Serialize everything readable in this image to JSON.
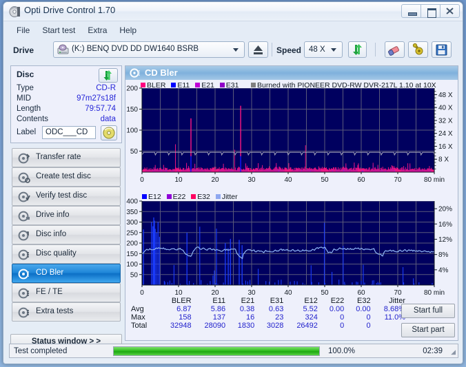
{
  "window": {
    "title": "Opti Drive Control 1.70",
    "icon": "disc-icon",
    "minimize": "minimize",
    "maximize": "maximize",
    "close": "close"
  },
  "menu": {
    "items": [
      {
        "label": "File"
      },
      {
        "label": "Start test"
      },
      {
        "label": "Extra"
      },
      {
        "label": "Help"
      }
    ]
  },
  "toolbar": {
    "drive_label": "Drive",
    "drive_value": "(K:)  BENQ DVD DD DW1640 BSRB",
    "eject_icon": "eject-icon",
    "speed_label": "Speed",
    "speed_value": "48 X",
    "refresh_icon": "refresh-icon",
    "erase_icon": "eraser-icon",
    "settings_icon": "settings-icon",
    "save_icon": "save-icon"
  },
  "disc": {
    "header": "Disc",
    "refresh_icon": "refresh-icon",
    "rows": [
      {
        "key": "Type",
        "value": "CD-R"
      },
      {
        "key": "MID",
        "value": "97m27s18f"
      },
      {
        "key": "Length",
        "value": "79:57.74"
      },
      {
        "key": "Contents",
        "value": "data"
      }
    ],
    "label_key": "Label",
    "label_value": "ODC___CD",
    "burn_icon": "cd-icon"
  },
  "nav": {
    "items": [
      {
        "label": "Transfer rate",
        "icon": "disc-test-icon",
        "selected": false
      },
      {
        "label": "Create test disc",
        "icon": "disc-test-icon",
        "selected": false
      },
      {
        "label": "Verify test disc",
        "icon": "disc-test-icon",
        "selected": false
      },
      {
        "label": "Drive info",
        "icon": "disc-test-icon",
        "selected": false
      },
      {
        "label": "Disc info",
        "icon": "disc-test-icon",
        "selected": false
      },
      {
        "label": "Disc quality",
        "icon": "disc-test-icon",
        "selected": false
      },
      {
        "label": "CD Bler",
        "icon": "disc-test-icon",
        "selected": true
      },
      {
        "label": "FE / TE",
        "icon": "disc-test-icon",
        "selected": false
      },
      {
        "label": "Extra tests",
        "icon": "disc-test-icon",
        "selected": false
      }
    ],
    "status_window_label": "Status window > >"
  },
  "panel": {
    "title": "CD Bler",
    "title_icon": "disc-test-icon",
    "burn_note": "Burned with PIONEER DVD-RW  DVR-217L 1.10 at 10X",
    "burn_note_swatch": "#808080",
    "start_full": "Start full",
    "start_part": "Start part"
  },
  "chart_data": [
    {
      "type": "line",
      "name": "bler-chart",
      "title": "",
      "xlabel": "min",
      "ylabel": "",
      "xlim": [
        0,
        80
      ],
      "ylim": [
        0,
        200
      ],
      "xticks": [
        0,
        10,
        20,
        30,
        40,
        50,
        60,
        70,
        80
      ],
      "xticklabels": [
        "0",
        "10",
        "20",
        "30",
        "40",
        "50",
        "60",
        "70",
        "80 min"
      ],
      "yticks": [
        50,
        100,
        150,
        200
      ],
      "yticklabels": [
        "50",
        "100",
        "150",
        "200"
      ],
      "right_axis": {
        "label": "X",
        "ticks": [
          8,
          16,
          24,
          32,
          40,
          48
        ],
        "ticklabels": [
          "8 X",
          "16 X",
          "24 X",
          "32 X",
          "40 X",
          "48 X"
        ],
        "lim": [
          0,
          52
        ]
      },
      "grid": true,
      "background": "#00005f",
      "legend_position": "top-left",
      "legend": [
        {
          "name": "BLER",
          "color": "#ff0080"
        },
        {
          "name": "E11",
          "color": "#0000ff"
        },
        {
          "name": "E21",
          "color": "#c000d8"
        },
        {
          "name": "E31",
          "color": "#9000c8"
        }
      ],
      "series": [
        {
          "name": "BLER",
          "color": "#ff0080",
          "avg": 6.87,
          "max": 158,
          "total": 32948
        },
        {
          "name": "E11",
          "color": "#0000ff",
          "avg": 5.86,
          "max": 137,
          "total": 28090
        },
        {
          "name": "E21",
          "color": "#c000d8",
          "avg": 0.38,
          "max": 16,
          "total": 1830
        },
        {
          "name": "E31",
          "color": "#9000c8",
          "avg": 0.63,
          "max": 23,
          "total": 3028
        },
        {
          "name": "Speed",
          "color": "#a0a0a0",
          "kind": "read-speed-curve"
        }
      ]
    },
    {
      "type": "line",
      "name": "e12-jitter-chart",
      "title": "",
      "xlabel": "min",
      "ylabel": "",
      "xlim": [
        0,
        80
      ],
      "ylim": [
        0,
        400
      ],
      "xticks": [
        0,
        10,
        20,
        30,
        40,
        50,
        60,
        70,
        80
      ],
      "xticklabels": [
        "0",
        "10",
        "20",
        "30",
        "40",
        "50",
        "60",
        "70",
        "80 min"
      ],
      "yticks": [
        50,
        100,
        150,
        200,
        250,
        300,
        350,
        400
      ],
      "yticklabels": [
        "50",
        "100",
        "150",
        "200",
        "250",
        "300",
        "350",
        "400"
      ],
      "right_axis": {
        "label": "%",
        "ticks": [
          4,
          8,
          12,
          16,
          20
        ],
        "ticklabels": [
          "4%",
          "8%",
          "12%",
          "16%",
          "20%"
        ],
        "lim": [
          0,
          22
        ]
      },
      "grid": true,
      "background": "#00005f",
      "legend_position": "top-left",
      "legend": [
        {
          "name": "E12",
          "color": "#0000ff"
        },
        {
          "name": "E22",
          "color": "#9000d8"
        },
        {
          "name": "E32",
          "color": "#ff0060"
        },
        {
          "name": "Jitter",
          "color": "#8fa8f0"
        }
      ],
      "series": [
        {
          "name": "E12",
          "color": "#0000ff",
          "avg": 5.52,
          "max": 324,
          "total": 26492
        },
        {
          "name": "E22",
          "color": "#9000d8",
          "avg": 0.0,
          "max": 0,
          "total": 0
        },
        {
          "name": "E32",
          "color": "#ff0060",
          "avg": 0.0,
          "max": 0,
          "total": 0
        },
        {
          "name": "Jitter",
          "color": "#8fa8f0",
          "avg": "8.68%",
          "max": "11.0%",
          "total": ""
        }
      ]
    }
  ],
  "stats": {
    "columns": [
      "BLER",
      "E11",
      "E21",
      "E31",
      "E12",
      "E22",
      "E32",
      "Jitter"
    ],
    "rows": [
      {
        "label": "Avg",
        "values": [
          "6.87",
          "5.86",
          "0.38",
          "0.63",
          "5.52",
          "0.00",
          "0.00",
          "8.68%"
        ]
      },
      {
        "label": "Max",
        "values": [
          "158",
          "137",
          "16",
          "23",
          "324",
          "0",
          "0",
          "11.0%"
        ]
      },
      {
        "label": "Total",
        "values": [
          "32948",
          "28090",
          "1830",
          "3028",
          "26492",
          "0",
          "0",
          ""
        ]
      }
    ]
  },
  "statusbar": {
    "status": "Test completed",
    "progress_pct": "100.0%",
    "progress_value": 100,
    "elapsed": "02:39"
  }
}
